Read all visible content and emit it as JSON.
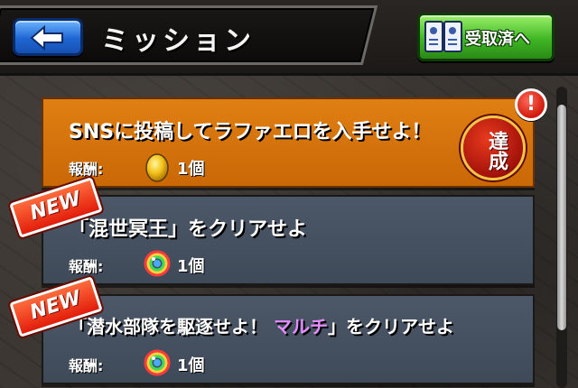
{
  "header": {
    "title": "ミッション",
    "received_button": "受取済へ"
  },
  "reward_label": "報酬:",
  "missions": [
    {
      "title": "SNSに投稿してラファエロを入手せよ！",
      "reward_icon": "golden-egg-icon",
      "reward_qty": "1個",
      "status": "achieved",
      "stamp": "達成",
      "alert": "!"
    },
    {
      "title": "「混世冥王」をクリアせよ",
      "reward_icon": "rainbow-orb-icon",
      "reward_qty": "1個",
      "status": "new",
      "badge": "NEW"
    },
    {
      "title_pre": "「潜水部隊を駆逐せよ！",
      "title_multi": "マルチ",
      "title_post": "」をクリアせよ",
      "reward_icon": "rainbow-orb-icon",
      "reward_qty": "1個",
      "status": "new",
      "badge": "NEW"
    }
  ],
  "colors": {
    "achieved_panel": "#d8740c",
    "normal_panel": "#46515f",
    "multi_text": "#e48cff",
    "back_button": "#1f66d4",
    "received_button": "#3fb624"
  }
}
